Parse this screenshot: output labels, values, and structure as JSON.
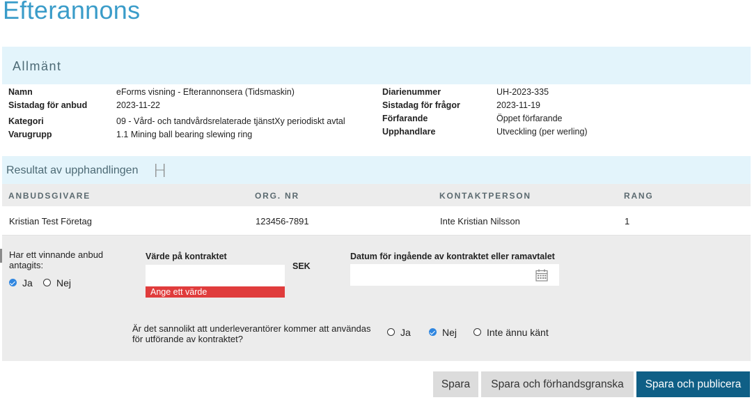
{
  "page_title": "Efterannons",
  "general": {
    "title": "Allmänt",
    "left": [
      {
        "label": "Namn",
        "value": "eForms visning - Efterannonsera (Tidsmaskin)"
      },
      {
        "label": "Sistadag för anbud",
        "value": "2023-11-22"
      },
      {
        "label": "Kategori",
        "value": "09 - Vård- och tandvårdsrelaterade tjänstXy periodiskt avtal"
      },
      {
        "label": "Varugrupp",
        "value": "1.1 Mining ball bearing slewing ring"
      }
    ],
    "right": [
      {
        "label": "Diarienummer",
        "value": "UH-2023-335"
      },
      {
        "label": "Sistadag för frågor",
        "value": "2023-11-19"
      },
      {
        "label": "Förfarande",
        "value": "Öppet förfarande"
      },
      {
        "label": "Upphandlare",
        "value": "Utveckling (per werling)"
      }
    ]
  },
  "result": {
    "title": "Resultat av upphandlingen",
    "heading_icon_label": "H",
    "columns": [
      "ANBUDSGIVARE",
      "ORG. NR",
      "KONTAKTPERSON",
      "RANG"
    ],
    "rows": [
      [
        "Kristian Test Företag",
        "123456-7891",
        "Inte Kristian Nilsson",
        "1"
      ]
    ]
  },
  "form": {
    "winner_question": "Har ett vinnande anbud antagits:",
    "winner_options": [
      {
        "label": "Ja",
        "checked": true
      },
      {
        "label": "Nej",
        "checked": false
      }
    ],
    "contract_value_label": "Värde på kontraktet",
    "contract_value": "",
    "currency": "SEK",
    "contract_value_error": "Ange ett värde",
    "date_label": "Datum för ingående av kontraktet eller ramavtalet",
    "date_value": "",
    "subcontractor_question": "Är det sannolikt att underleverantörer kommer att användas för utförande av kontraktet?",
    "subcontractor_options": [
      {
        "label": "Ja",
        "checked": false
      },
      {
        "label": "Nej",
        "checked": true
      },
      {
        "label": "Inte ännu känt",
        "checked": false
      }
    ]
  },
  "buttons": {
    "save": "Spara",
    "save_preview": "Spara och förhandsgranska",
    "save_publish": "Spara och publicera"
  },
  "colors": {
    "title": "#3a9cc9",
    "section_bg": "#e3f4fb",
    "primary_button": "#0f5f86",
    "error": "#e03c3c",
    "radio_checked": "#2f86e0"
  }
}
